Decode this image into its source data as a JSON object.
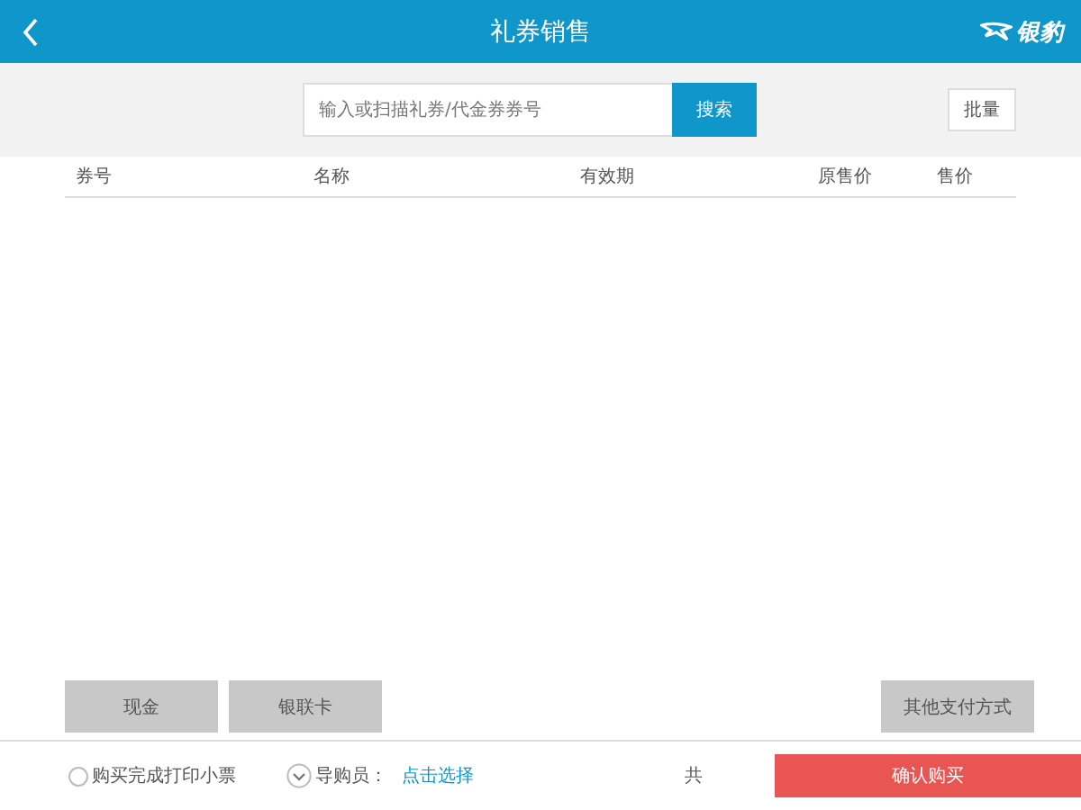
{
  "header": {
    "title": "礼券销售",
    "logo": "银豹"
  },
  "search": {
    "placeholder": "输入或扫描礼券/代金券券号",
    "button": "搜索",
    "batch": "批量"
  },
  "table": {
    "columns": [
      "券号",
      "名称",
      "有效期",
      "原售价",
      "售价"
    ]
  },
  "payments": [
    {
      "label": "现金",
      "kind": "left"
    },
    {
      "label": "银联卡",
      "kind": "left"
    },
    {
      "label": "其他支付方式",
      "kind": "right"
    }
  ],
  "footer": {
    "print_receipt": {
      "label": "购买完成打印小票",
      "checked": false
    },
    "guide": {
      "label": "导购员：",
      "link": "点击选择"
    },
    "total": "共",
    "confirm": "确认购买"
  }
}
